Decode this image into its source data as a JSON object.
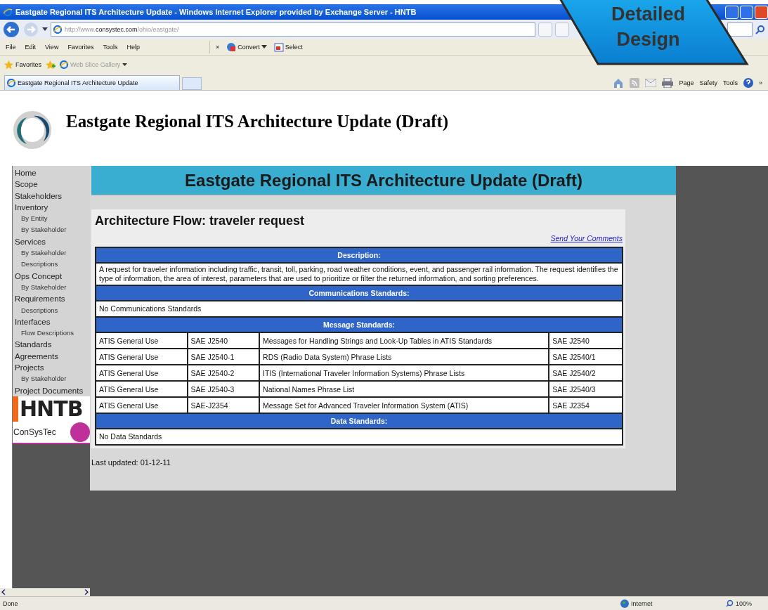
{
  "window": {
    "title": "Eastgate Regional ITS Architecture Update - Windows Internet Explorer provided by Exchange Server - HNTB"
  },
  "address_bar": {
    "url_prefix": "http://www.",
    "url_domain": "consystec.com",
    "url_path": "/ohio/eastgate/"
  },
  "menu": [
    "File",
    "Edit",
    "View",
    "Favorites",
    "Tools",
    "Help"
  ],
  "toolbar": [
    {
      "kind": "stop",
      "label": "×"
    },
    {
      "kind": "convert",
      "label": "Convert"
    },
    {
      "kind": "select",
      "label": "Select"
    }
  ],
  "favorites_bar": {
    "label": "Favorites",
    "items": [
      "Web Slice Gallery"
    ]
  },
  "tabs": [
    {
      "label": "Eastgate Regional ITS Architecture Update",
      "selected": true
    }
  ],
  "command_bar": [
    "Page",
    "Safety",
    "Tools"
  ],
  "command_more": "»",
  "callout": {
    "text": "Detailed Design"
  },
  "page": {
    "site_title": "Eastgate Regional ITS Architecture Update (Draft)",
    "sidebar": {
      "items": [
        {
          "label": "Home"
        },
        {
          "label": "Scope"
        },
        {
          "label": "Stakeholders"
        },
        {
          "label": "Inventory",
          "children": [
            {
              "label": "By Entity"
            },
            {
              "label": "By Stakeholder"
            }
          ]
        },
        {
          "label": "Services",
          "children": [
            {
              "label": "By Stakeholder"
            },
            {
              "label": "Descriptions"
            }
          ]
        },
        {
          "label": "Ops Concept",
          "children": [
            {
              "label": "By Stakeholder"
            }
          ]
        },
        {
          "label": "Requirements",
          "children": [
            {
              "label": "Descriptions"
            }
          ]
        },
        {
          "label": "Interfaces",
          "children": [
            {
              "label": "Flow Descriptions"
            }
          ]
        },
        {
          "label": "Standards"
        },
        {
          "label": "Agreements"
        },
        {
          "label": "Projects",
          "children": [
            {
              "label": "By Stakeholder"
            }
          ]
        },
        {
          "label": "Project Documents"
        }
      ],
      "logos": [
        "HNTB",
        "ConSysTec"
      ]
    },
    "banner": "Eastgate Regional ITS Architecture Update (Draft)",
    "heading": "Architecture Flow: traveler request",
    "comments_link": "Send Your Comments",
    "sections": [
      {
        "header": "Description:",
        "kind": "text",
        "text": "A request for traveler information including traffic, transit, toll, parking, road weather conditions, event, and passenger rail information. The request identifies the type of information, the area of interest, parameters that are used to prioritize or filter the returned information, and sorting preferences."
      },
      {
        "header": "Communications Standards:",
        "kind": "text",
        "text": "No Communications Standards"
      },
      {
        "header": "Message Standards:",
        "kind": "rows",
        "rows": [
          [
            "ATIS General Use",
            "SAE J2540",
            "Messages for Handling Strings and Look-Up Tables in ATIS Standards",
            "SAE J2540"
          ],
          [
            "ATIS General Use",
            "SAE J2540-1",
            "RDS (Radio Data System) Phrase Lists",
            "SAE J2540/1"
          ],
          [
            "ATIS General Use",
            "SAE J2540-2",
            "ITIS (International Traveler Information Systems) Phrase Lists",
            "SAE J2540/2"
          ],
          [
            "ATIS General Use",
            "SAE J2540-3",
            "National Names Phrase List",
            "SAE J2540/3"
          ],
          [
            "ATIS General Use",
            "SAE-J2354",
            "Message Set for Advanced Traveler Information System (ATIS)",
            "SAE J2354"
          ]
        ]
      },
      {
        "header": "Data Standards:",
        "kind": "text",
        "text": "No Data Standards"
      }
    ],
    "last_updated": "Last updated: 01-12-11"
  },
  "status_bar": {
    "status": "Done",
    "zone": "Internet",
    "zoom": "100%"
  }
}
